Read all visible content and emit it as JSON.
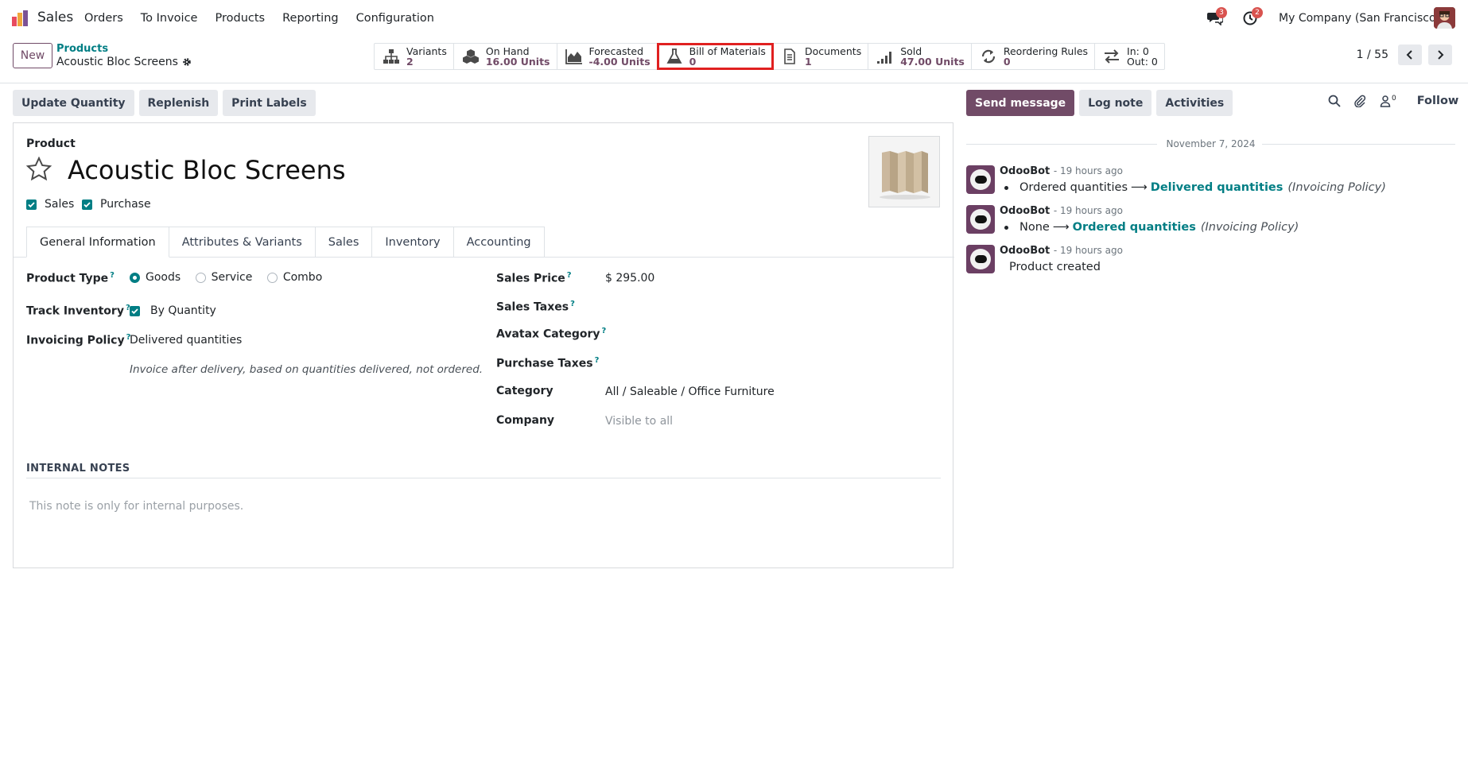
{
  "topnav": {
    "app_name": "Sales",
    "menu": [
      "Orders",
      "To Invoice",
      "Products",
      "Reporting",
      "Configuration"
    ],
    "messages_badge": "3",
    "activities_badge": "2",
    "company": "My Company (San Francisco)"
  },
  "control": {
    "new_label": "New",
    "breadcrumb_parent": "Products",
    "breadcrumb_current": "Acoustic Bloc Screens",
    "pager": "1 / 55"
  },
  "smart_buttons": [
    {
      "label": "Variants",
      "value": "2",
      "icon": "sitemap-icon"
    },
    {
      "label": "On Hand",
      "value": "16.00 Units",
      "icon": "cubes-icon"
    },
    {
      "label": "Forecasted",
      "value": "-4.00 Units",
      "icon": "area-chart-icon"
    },
    {
      "label": "Bill of Materials",
      "value": "0",
      "icon": "flask-icon"
    },
    {
      "label": "Documents",
      "value": "1",
      "icon": "file-text-icon"
    },
    {
      "label": "Sold",
      "value": "47.00 Units",
      "icon": "signal-icon"
    },
    {
      "label": "Reordering Rules",
      "value": "0",
      "icon": "refresh-icon"
    },
    {
      "in": "In: 0",
      "out": "Out: 0",
      "icon": "exchange-icon"
    }
  ],
  "actions": [
    "Update Quantity",
    "Replenish",
    "Print Labels"
  ],
  "form": {
    "product_label": "Product",
    "product_name": "Acoustic Bloc Screens",
    "sales_check": "Sales",
    "purchase_check": "Purchase",
    "tabs": [
      "General Information",
      "Attributes & Variants",
      "Sales",
      "Inventory",
      "Accounting"
    ],
    "product_type_label": "Product Type",
    "product_type_options": [
      "Goods",
      "Service",
      "Combo"
    ],
    "track_inventory_label": "Track Inventory",
    "track_inventory_value": "By Quantity",
    "invoicing_policy_label": "Invoicing Policy",
    "invoicing_policy_value": "Delivered quantities",
    "invoicing_policy_hint": "Invoice after delivery, based on quantities delivered, not ordered.",
    "sales_price_label": "Sales Price",
    "sales_price_value": "$ 295.00",
    "sales_taxes_label": "Sales Taxes",
    "avatax_label": "Avatax Category",
    "purchase_taxes_label": "Purchase Taxes",
    "category_label": "Category",
    "category_value": "All / Saleable / Office Furniture",
    "company_label": "Company",
    "company_placeholder": "Visible to all",
    "notes_title": "INTERNAL NOTES",
    "notes_placeholder": "This note is only for internal purposes."
  },
  "chatter": {
    "send_message": "Send message",
    "log_note": "Log note",
    "activities": "Activities",
    "follower_count": "0",
    "follow": "Follow",
    "date": "November 7, 2024",
    "messages": [
      {
        "author": "OdooBot",
        "time": "- 19 hours ago",
        "old": "Ordered quantities",
        "new": "Delivered quantities",
        "field": "(Invoicing Policy)"
      },
      {
        "author": "OdooBot",
        "time": "- 19 hours ago",
        "old": "None",
        "new": "Ordered quantities",
        "field": "(Invoicing Policy)"
      },
      {
        "author": "OdooBot",
        "time": "- 19 hours ago",
        "text": "Product created"
      }
    ]
  },
  "colors": {
    "brand": "#714b67",
    "accent": "#017e84",
    "highlight": "#e02020"
  }
}
